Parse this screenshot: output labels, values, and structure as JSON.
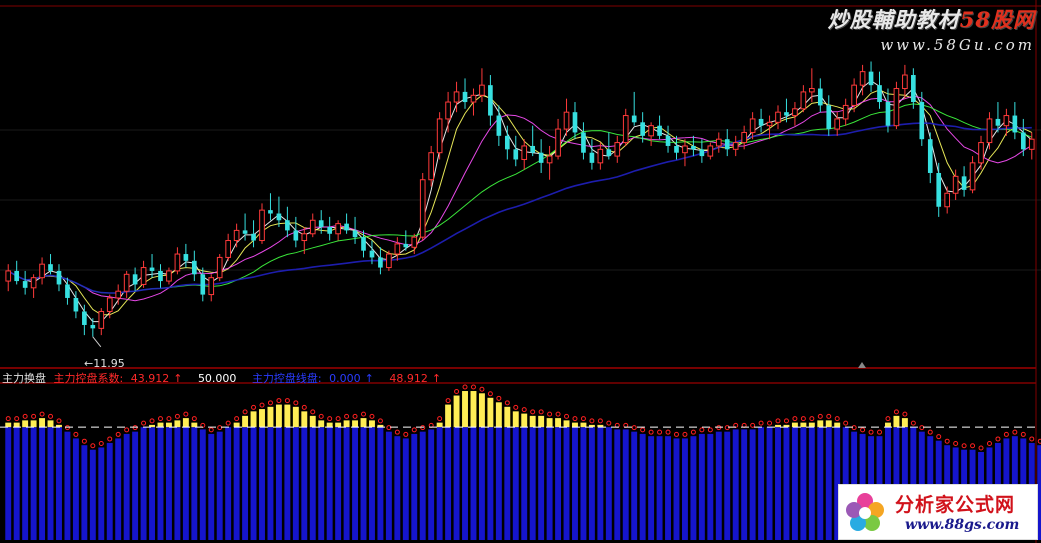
{
  "watermark": {
    "line1_prefix": "炒股輔助教材",
    "line1_red": "58股网",
    "line2": "www.58Gu.com"
  },
  "logo": {
    "name": "分析家公式网",
    "url": "www.88gs.com"
  },
  "indicator_legend": {
    "title": "主力换盘",
    "items": [
      {
        "label": "主力控盘系数:",
        "value": "43.912",
        "arrow": "↑",
        "color": "#ff2a2a"
      },
      {
        "label": "",
        "value": "50.000",
        "arrow": "",
        "color": "#ffffff"
      },
      {
        "label": "主力控盘线盘:",
        "value": "0.000",
        "arrow": "↑",
        "color": "#2a3cff"
      },
      {
        "label": "",
        "value": "48.912",
        "arrow": "↑",
        "color": "#ff2a2a"
      }
    ]
  },
  "low_price_label": "11.95",
  "colors": {
    "up": "#ff3a3a",
    "down": "#37e0e0",
    "ma1": "#ffffff",
    "ma2": "#ffff60",
    "ma3": "#ff50ff",
    "ma4": "#40ff40",
    "ma5": "#2020c0",
    "ind_yellow": "#ffee55",
    "ind_blue": "#1515cc",
    "ind_red": "#ff2020",
    "divider": "#c00000"
  },
  "chart_data": {
    "type": "candlestick",
    "title": "",
    "ylim": [
      11.5,
      20.5
    ],
    "candles": [
      {
        "o": 13.6,
        "h": 14.1,
        "l": 13.3,
        "c": 13.9
      },
      {
        "o": 13.9,
        "h": 14.2,
        "l": 13.5,
        "c": 13.6
      },
      {
        "o": 13.6,
        "h": 13.9,
        "l": 13.2,
        "c": 13.4
      },
      {
        "o": 13.4,
        "h": 13.8,
        "l": 13.1,
        "c": 13.7
      },
      {
        "o": 13.7,
        "h": 14.3,
        "l": 13.5,
        "c": 14.1
      },
      {
        "o": 14.1,
        "h": 14.4,
        "l": 13.8,
        "c": 13.9
      },
      {
        "o": 13.9,
        "h": 14.1,
        "l": 13.3,
        "c": 13.5
      },
      {
        "o": 13.5,
        "h": 13.7,
        "l": 12.9,
        "c": 13.1
      },
      {
        "o": 13.1,
        "h": 13.3,
        "l": 12.5,
        "c": 12.7
      },
      {
        "o": 12.7,
        "h": 12.9,
        "l": 12.0,
        "c": 12.3
      },
      {
        "o": 12.3,
        "h": 12.5,
        "l": 11.95,
        "c": 12.2
      },
      {
        "o": 12.2,
        "h": 12.8,
        "l": 12.0,
        "c": 12.7
      },
      {
        "o": 12.7,
        "h": 13.2,
        "l": 12.5,
        "c": 13.1
      },
      {
        "o": 13.1,
        "h": 13.5,
        "l": 12.9,
        "c": 13.3
      },
      {
        "o": 13.3,
        "h": 13.9,
        "l": 13.1,
        "c": 13.8
      },
      {
        "o": 13.8,
        "h": 14.0,
        "l": 13.3,
        "c": 13.5
      },
      {
        "o": 13.5,
        "h": 14.2,
        "l": 13.4,
        "c": 14.0
      },
      {
        "o": 14.0,
        "h": 14.4,
        "l": 13.7,
        "c": 13.9
      },
      {
        "o": 13.9,
        "h": 14.1,
        "l": 13.4,
        "c": 13.6
      },
      {
        "o": 13.6,
        "h": 14.0,
        "l": 13.5,
        "c": 13.9
      },
      {
        "o": 13.9,
        "h": 14.6,
        "l": 13.8,
        "c": 14.4
      },
      {
        "o": 14.4,
        "h": 14.7,
        "l": 14.0,
        "c": 14.2
      },
      {
        "o": 14.2,
        "h": 14.5,
        "l": 13.6,
        "c": 13.8
      },
      {
        "o": 13.8,
        "h": 14.0,
        "l": 13.0,
        "c": 13.2
      },
      {
        "o": 13.2,
        "h": 13.8,
        "l": 13.0,
        "c": 13.7
      },
      {
        "o": 13.7,
        "h": 14.4,
        "l": 13.6,
        "c": 14.3
      },
      {
        "o": 14.3,
        "h": 15.0,
        "l": 14.2,
        "c": 14.8
      },
      {
        "o": 14.8,
        "h": 15.3,
        "l": 14.6,
        "c": 15.1
      },
      {
        "o": 15.1,
        "h": 15.6,
        "l": 14.8,
        "c": 15.0
      },
      {
        "o": 15.0,
        "h": 15.4,
        "l": 14.6,
        "c": 14.8
      },
      {
        "o": 14.8,
        "h": 15.9,
        "l": 14.7,
        "c": 15.7
      },
      {
        "o": 15.7,
        "h": 16.2,
        "l": 15.4,
        "c": 15.6
      },
      {
        "o": 15.6,
        "h": 16.1,
        "l": 15.2,
        "c": 15.4
      },
      {
        "o": 15.4,
        "h": 15.8,
        "l": 14.9,
        "c": 15.1
      },
      {
        "o": 15.1,
        "h": 15.5,
        "l": 14.6,
        "c": 14.8
      },
      {
        "o": 14.8,
        "h": 15.2,
        "l": 14.4,
        "c": 15.0
      },
      {
        "o": 15.0,
        "h": 15.6,
        "l": 14.9,
        "c": 15.4
      },
      {
        "o": 15.4,
        "h": 15.7,
        "l": 15.0,
        "c": 15.2
      },
      {
        "o": 15.2,
        "h": 15.5,
        "l": 14.8,
        "c": 15.0
      },
      {
        "o": 15.0,
        "h": 15.4,
        "l": 14.8,
        "c": 15.3
      },
      {
        "o": 15.3,
        "h": 15.6,
        "l": 15.0,
        "c": 15.1
      },
      {
        "o": 15.1,
        "h": 15.5,
        "l": 14.7,
        "c": 14.9
      },
      {
        "o": 14.9,
        "h": 15.1,
        "l": 14.3,
        "c": 14.5
      },
      {
        "o": 14.5,
        "h": 14.8,
        "l": 14.1,
        "c": 14.3
      },
      {
        "o": 14.3,
        "h": 14.6,
        "l": 13.8,
        "c": 14.0
      },
      {
        "o": 14.0,
        "h": 14.5,
        "l": 13.9,
        "c": 14.4
      },
      {
        "o": 14.4,
        "h": 14.9,
        "l": 14.2,
        "c": 14.7
      },
      {
        "o": 14.7,
        "h": 15.1,
        "l": 14.5,
        "c": 14.6
      },
      {
        "o": 14.6,
        "h": 15.0,
        "l": 14.4,
        "c": 14.9
      },
      {
        "o": 14.9,
        "h": 16.8,
        "l": 14.8,
        "c": 16.6
      },
      {
        "o": 16.6,
        "h": 17.6,
        "l": 16.4,
        "c": 17.4
      },
      {
        "o": 17.4,
        "h": 18.6,
        "l": 17.2,
        "c": 18.4
      },
      {
        "o": 18.4,
        "h": 19.2,
        "l": 18.0,
        "c": 18.9
      },
      {
        "o": 18.9,
        "h": 19.5,
        "l": 18.6,
        "c": 19.2
      },
      {
        "o": 19.2,
        "h": 19.6,
        "l": 18.7,
        "c": 18.9
      },
      {
        "o": 18.9,
        "h": 19.3,
        "l": 18.5,
        "c": 19.1
      },
      {
        "o": 19.1,
        "h": 19.9,
        "l": 18.9,
        "c": 19.4
      },
      {
        "o": 19.4,
        "h": 19.7,
        "l": 18.2,
        "c": 18.5
      },
      {
        "o": 18.5,
        "h": 18.8,
        "l": 17.6,
        "c": 17.9
      },
      {
        "o": 17.9,
        "h": 18.2,
        "l": 17.2,
        "c": 17.5
      },
      {
        "o": 17.5,
        "h": 17.9,
        "l": 17.0,
        "c": 17.2
      },
      {
        "o": 17.2,
        "h": 17.8,
        "l": 16.9,
        "c": 17.6
      },
      {
        "o": 17.6,
        "h": 18.2,
        "l": 17.3,
        "c": 17.4
      },
      {
        "o": 17.4,
        "h": 17.8,
        "l": 16.8,
        "c": 17.1
      },
      {
        "o": 17.1,
        "h": 17.6,
        "l": 16.6,
        "c": 17.3
      },
      {
        "o": 17.3,
        "h": 18.4,
        "l": 17.2,
        "c": 18.1
      },
      {
        "o": 18.1,
        "h": 19.0,
        "l": 17.9,
        "c": 18.6
      },
      {
        "o": 18.6,
        "h": 18.9,
        "l": 17.8,
        "c": 18.0
      },
      {
        "o": 18.0,
        "h": 18.3,
        "l": 17.2,
        "c": 17.4
      },
      {
        "o": 17.4,
        "h": 17.8,
        "l": 16.9,
        "c": 17.1
      },
      {
        "o": 17.1,
        "h": 17.7,
        "l": 16.9,
        "c": 17.5
      },
      {
        "o": 17.5,
        "h": 18.0,
        "l": 17.2,
        "c": 17.3
      },
      {
        "o": 17.3,
        "h": 17.9,
        "l": 17.1,
        "c": 17.7
      },
      {
        "o": 17.7,
        "h": 18.7,
        "l": 17.6,
        "c": 18.5
      },
      {
        "o": 18.5,
        "h": 19.2,
        "l": 18.2,
        "c": 18.3
      },
      {
        "o": 18.3,
        "h": 18.6,
        "l": 17.7,
        "c": 17.9
      },
      {
        "o": 17.9,
        "h": 18.3,
        "l": 17.6,
        "c": 18.2
      },
      {
        "o": 18.2,
        "h": 18.5,
        "l": 17.8,
        "c": 17.9
      },
      {
        "o": 17.9,
        "h": 18.2,
        "l": 17.4,
        "c": 17.6
      },
      {
        "o": 17.6,
        "h": 17.9,
        "l": 17.2,
        "c": 17.4
      },
      {
        "o": 17.4,
        "h": 17.8,
        "l": 17.0,
        "c": 17.6
      },
      {
        "o": 17.6,
        "h": 17.9,
        "l": 17.3,
        "c": 17.5
      },
      {
        "o": 17.5,
        "h": 17.8,
        "l": 17.1,
        "c": 17.3
      },
      {
        "o": 17.3,
        "h": 17.7,
        "l": 17.2,
        "c": 17.6
      },
      {
        "o": 17.6,
        "h": 18.0,
        "l": 17.4,
        "c": 17.8
      },
      {
        "o": 17.8,
        "h": 18.1,
        "l": 17.3,
        "c": 17.5
      },
      {
        "o": 17.5,
        "h": 17.9,
        "l": 17.3,
        "c": 17.7
      },
      {
        "o": 17.7,
        "h": 18.2,
        "l": 17.5,
        "c": 18.0
      },
      {
        "o": 18.0,
        "h": 18.6,
        "l": 17.8,
        "c": 18.4
      },
      {
        "o": 18.4,
        "h": 18.7,
        "l": 18.0,
        "c": 18.2
      },
      {
        "o": 18.2,
        "h": 18.5,
        "l": 17.8,
        "c": 18.3
      },
      {
        "o": 18.3,
        "h": 18.8,
        "l": 18.1,
        "c": 18.6
      },
      {
        "o": 18.6,
        "h": 19.0,
        "l": 18.3,
        "c": 18.5
      },
      {
        "o": 18.5,
        "h": 18.9,
        "l": 18.2,
        "c": 18.7
      },
      {
        "o": 18.7,
        "h": 19.4,
        "l": 18.6,
        "c": 19.2
      },
      {
        "o": 19.2,
        "h": 19.9,
        "l": 18.9,
        "c": 19.3
      },
      {
        "o": 19.3,
        "h": 19.6,
        "l": 18.6,
        "c": 18.8
      },
      {
        "o": 18.8,
        "h": 19.1,
        "l": 17.9,
        "c": 18.1
      },
      {
        "o": 18.1,
        "h": 18.6,
        "l": 17.9,
        "c": 18.4
      },
      {
        "o": 18.4,
        "h": 19.0,
        "l": 18.2,
        "c": 18.8
      },
      {
        "o": 18.8,
        "h": 19.6,
        "l": 18.6,
        "c": 19.4
      },
      {
        "o": 19.4,
        "h": 20.0,
        "l": 19.1,
        "c": 19.8
      },
      {
        "o": 19.8,
        "h": 20.1,
        "l": 19.2,
        "c": 19.4
      },
      {
        "o": 19.4,
        "h": 19.8,
        "l": 18.7,
        "c": 18.9
      },
      {
        "o": 18.9,
        "h": 19.3,
        "l": 18.0,
        "c": 18.2
      },
      {
        "o": 18.2,
        "h": 19.5,
        "l": 18.1,
        "c": 19.3
      },
      {
        "o": 19.3,
        "h": 20.0,
        "l": 19.0,
        "c": 19.7
      },
      {
        "o": 19.7,
        "h": 19.9,
        "l": 18.7,
        "c": 18.9
      },
      {
        "o": 18.9,
        "h": 19.2,
        "l": 17.6,
        "c": 17.8
      },
      {
        "o": 17.8,
        "h": 18.0,
        "l": 16.5,
        "c": 16.8
      },
      {
        "o": 16.8,
        "h": 17.1,
        "l": 15.5,
        "c": 15.8
      },
      {
        "o": 15.8,
        "h": 16.4,
        "l": 15.6,
        "c": 16.2
      },
      {
        "o": 16.2,
        "h": 16.9,
        "l": 16.0,
        "c": 16.7
      },
      {
        "o": 16.7,
        "h": 17.0,
        "l": 16.1,
        "c": 16.3
      },
      {
        "o": 16.3,
        "h": 17.3,
        "l": 16.2,
        "c": 17.1
      },
      {
        "o": 17.1,
        "h": 17.9,
        "l": 16.9,
        "c": 17.7
      },
      {
        "o": 17.7,
        "h": 18.6,
        "l": 17.5,
        "c": 18.4
      },
      {
        "o": 18.4,
        "h": 18.9,
        "l": 18.0,
        "c": 18.2
      },
      {
        "o": 18.2,
        "h": 18.7,
        "l": 17.9,
        "c": 18.5
      },
      {
        "o": 18.5,
        "h": 18.9,
        "l": 17.8,
        "c": 18.0
      },
      {
        "o": 18.0,
        "h": 18.4,
        "l": 17.3,
        "c": 17.5
      },
      {
        "o": 17.5,
        "h": 18.0,
        "l": 17.2,
        "c": 17.8
      }
    ],
    "indicator": {
      "name": "主力换盘",
      "threshold": 50.0,
      "values": [
        52,
        52,
        53,
        53,
        54,
        53,
        51,
        48,
        45,
        42,
        40,
        41,
        43,
        45,
        47,
        48,
        50,
        51,
        52,
        52,
        53,
        54,
        52,
        49,
        47,
        48,
        50,
        52,
        55,
        57,
        58,
        59,
        60,
        60,
        59,
        57,
        55,
        53,
        52,
        52,
        53,
        53,
        54,
        53,
        51,
        48,
        46,
        45,
        47,
        48,
        49,
        52,
        60,
        64,
        66,
        66,
        65,
        63,
        61,
        59,
        57,
        56,
        55,
        55,
        54,
        54,
        53,
        52,
        52,
        51,
        51,
        50,
        49,
        49,
        48,
        47,
        46,
        46,
        46,
        45,
        45,
        46,
        47,
        47,
        48,
        48,
        49,
        49,
        49,
        50,
        50,
        51,
        51,
        52,
        52,
        52,
        53,
        53,
        52,
        50,
        48,
        47,
        46,
        46,
        52,
        55,
        54,
        50,
        48,
        46,
        44,
        42,
        41,
        40,
        40,
        39,
        41,
        43,
        45,
        46,
        45,
        43,
        42
      ]
    }
  }
}
